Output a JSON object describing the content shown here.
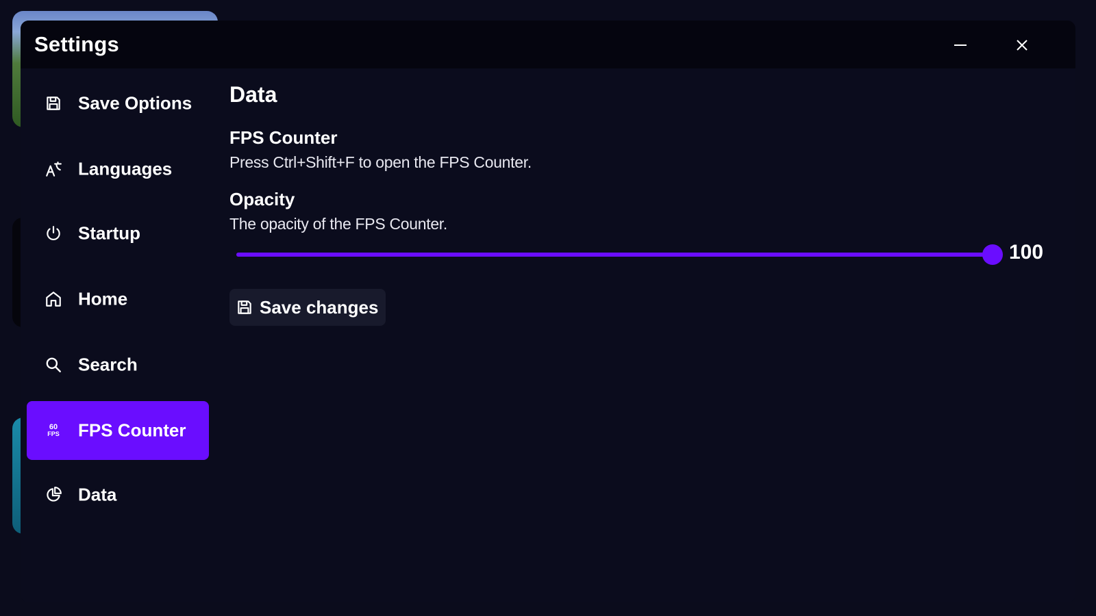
{
  "window": {
    "title": "Settings"
  },
  "sidebar": {
    "items": [
      {
        "label": "Save Options",
        "icon": "save-icon",
        "active": false
      },
      {
        "label": "Languages",
        "icon": "languages-icon",
        "active": false
      },
      {
        "label": "Startup",
        "icon": "power-icon",
        "active": false
      },
      {
        "label": "Home",
        "icon": "home-icon",
        "active": false
      },
      {
        "label": "Search",
        "icon": "search-icon",
        "active": false
      },
      {
        "label": "FPS Counter",
        "icon": "fps-icon",
        "icon_text_top": "60",
        "icon_text_bottom": "FPS",
        "active": true
      },
      {
        "label": "Data",
        "icon": "pie-chart-icon",
        "active": false
      }
    ]
  },
  "main": {
    "section_title": "Data",
    "fps_counter": {
      "title": "FPS Counter",
      "description": "Press Ctrl+Shift+F to open the FPS Counter."
    },
    "opacity": {
      "title": "Opacity",
      "description": "The opacity of the FPS Counter.",
      "value": "100",
      "min": 0,
      "max": 100
    },
    "save_button": {
      "label": "Save changes",
      "icon": "save-icon"
    }
  },
  "colors": {
    "accent": "#6a0dff",
    "background": "#0b0c1d",
    "titlebar": "#05050f",
    "button_bg": "#181a2c"
  }
}
